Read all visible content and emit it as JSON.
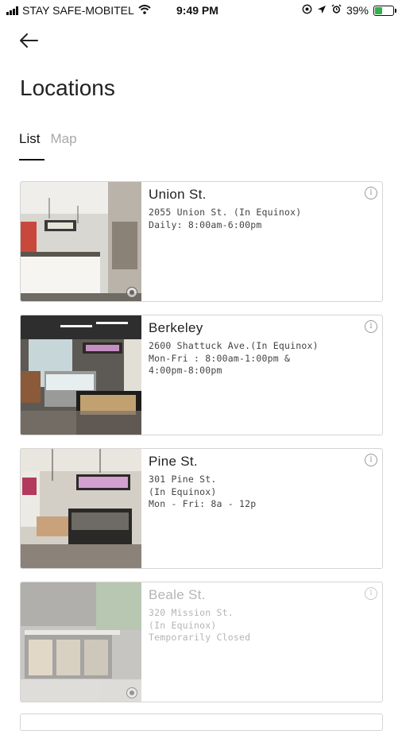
{
  "status_bar": {
    "carrier": "STAY SAFE-MOBITEL",
    "time": "9:49 PM",
    "battery": "39%",
    "battery_level": 0.39,
    "icons": [
      "signal-icon",
      "wifi-icon",
      "location-lock-icon",
      "location-arrow-icon",
      "alarm-icon",
      "battery-icon"
    ]
  },
  "header": {
    "back_icon": "arrow-left-icon",
    "title": "Locations"
  },
  "tabs": [
    {
      "label": "List",
      "active": true
    },
    {
      "label": "Map",
      "active": false
    }
  ],
  "locations": [
    {
      "name": "Union St.",
      "lines": [
        "2055 Union St. (In Equinox)",
        "Daily: 8:00am-6:00pm"
      ],
      "closed": false
    },
    {
      "name": "Berkeley",
      "lines": [
        "2600 Shattuck Ave.(In Equinox)",
        "Mon-Fri : 8:00am-1:00pm &",
        "4:00pm-8:00pm"
      ],
      "closed": false
    },
    {
      "name": "Pine St.",
      "lines": [
        "301 Pine St.",
        "(In Equinox)",
        "Mon - Fri: 8a - 12p"
      ],
      "closed": false
    },
    {
      "name": "Beale St.",
      "lines": [
        "320 Mission St.",
        "(In Equinox)",
        "Temporarily Closed"
      ],
      "closed": true
    }
  ],
  "colors": {
    "accent": "#111111",
    "inactive_tab": "#a8a8a8",
    "closed_text": "#b5b5b5",
    "battery_fill": "#2fb34a"
  }
}
